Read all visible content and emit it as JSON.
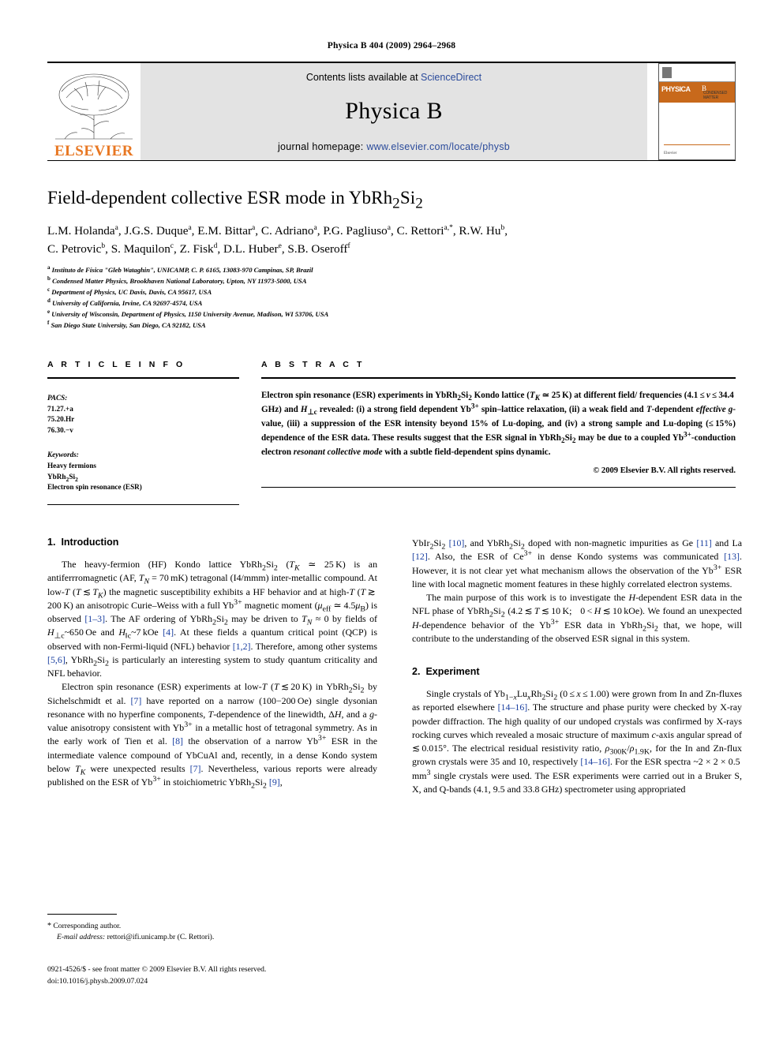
{
  "running_head": "Physica B 404 (2009) 2964–2968",
  "masthead": {
    "contents_prefix": "Contents lists available at ",
    "sciencedirect": "ScienceDirect",
    "journal_name": "Physica B",
    "homepage_prefix": "journal homepage: ",
    "homepage_url": "www.elsevier.com/locate/physb",
    "publisher_wordmark": "ELSEVIER",
    "cover": {
      "journal_title": "PHYSICA",
      "volume_letter": "B",
      "subtitle": "CONDENSED MATTER",
      "footer_left": "Elsevier"
    },
    "link_color": "#2b4b9b",
    "accent_color": "#E87722"
  },
  "article": {
    "title_parts": [
      "Field-dependent collective ESR mode in YbRh",
      "2",
      "Si",
      "2"
    ],
    "authors_line1": "L.M. Holanda a, J.G.S. Duque a, E.M. Bittar a, C. Adriano a, P.G. Pagliuso a, C. Rettori a,*, R.W. Hu b,",
    "authors_line2": "C. Petrovic b, S. Maquilon c, Z. Fisk d, D.L. Huber e, S.B. Oseroff f",
    "affiliations": [
      {
        "mark": "a",
        "text": "Instituto de Física \"Gleb Wataghin\", UNICAMP, C. P. 6165, 13083-970 Campinas, SP, Brazil"
      },
      {
        "mark": "b",
        "text": "Condensed Matter Physics, Brookhaven National Laboratory, Upton, NY 11973-5000, USA"
      },
      {
        "mark": "c",
        "text": "Department of Physics, UC Davis, Davis, CA 95617, USA"
      },
      {
        "mark": "d",
        "text": "University of California, Irvine, CA 92697-4574, USA"
      },
      {
        "mark": "e",
        "text": "University of Wisconsin, Department of Physics, 1150 University Avenue, Madison, WI 53706, USA"
      },
      {
        "mark": "f",
        "text": "San Diego State University, San Diego, CA 92182, USA"
      }
    ]
  },
  "article_info": {
    "heading": "A R T I C L E   I N F O",
    "pacs_label": "PACS:",
    "pacs": [
      "71.27.+a",
      "75.20.Hr",
      "76.30.−v"
    ],
    "keywords_label": "Keywords:",
    "keywords_plain": [
      "Heavy fermions",
      "Electron spin resonance (ESR)"
    ],
    "keyword_formula": "YbRh2Si2"
  },
  "abstract": {
    "heading": "A B S T R A C T",
    "copyright": "© 2009 Elsevier B.V. All rights reserved."
  },
  "sections": {
    "introduction": {
      "number": "1.",
      "title": "Introduction"
    },
    "experiment": {
      "number": "2.",
      "title": "Experiment"
    }
  },
  "footnote": {
    "corresponding": "Corresponding author.",
    "email_label": "E-mail address:",
    "email": "rettori@ifi.unicamp.br (C. Rettori)."
  },
  "imprint": {
    "line1": "0921-4526/$ - see front matter © 2009 Elsevier B.V. All rights reserved.",
    "line2": "doi:10.1016/j.physb.2009.07.024"
  }
}
